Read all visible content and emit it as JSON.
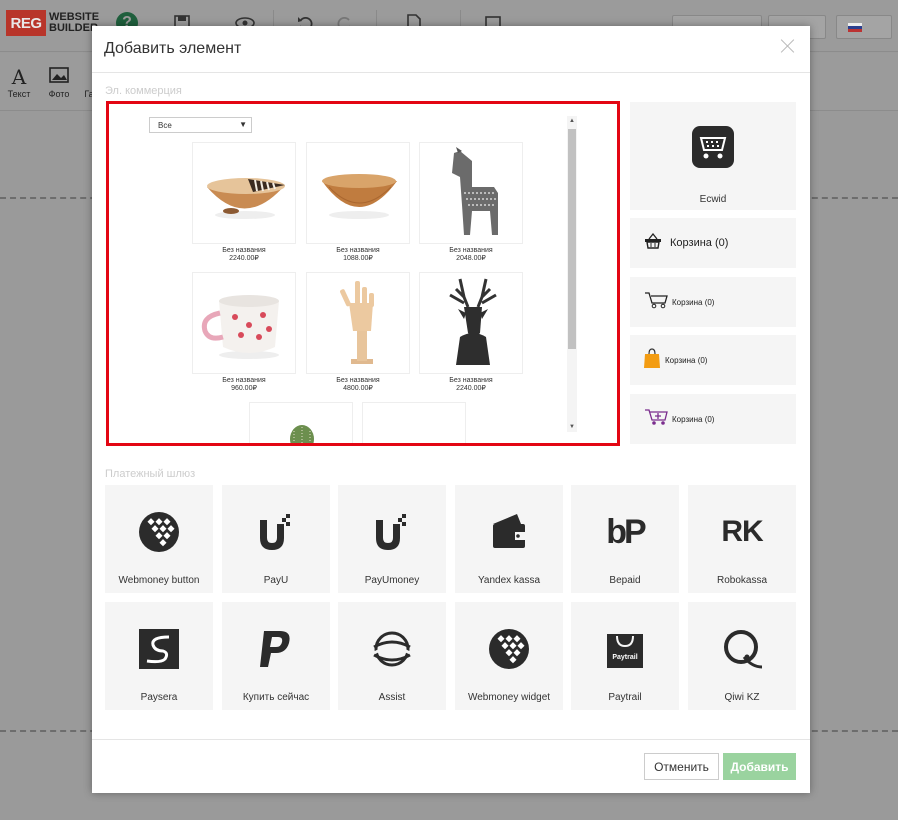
{
  "app": {
    "logo_mark": "REG",
    "logo_line1": "WEBSITE",
    "logo_line2": "BUILDER",
    "help_glyph": "?",
    "tools": [
      {
        "label": "Текст",
        "glyph": "A"
      },
      {
        "label": "Фото",
        "glyph": "▣"
      },
      {
        "label": "Га",
        "glyph": ""
      }
    ]
  },
  "modal": {
    "title": "Добавить элемент",
    "ecommerce_label": "Эл. коммерция",
    "payment_label": "Платежный шлюз",
    "preview": {
      "filter_value": "Все",
      "products": [
        {
          "name": "Без названия",
          "price": "2240.00₽",
          "kind": "bowl-striped"
        },
        {
          "name": "Без названия",
          "price": "1088.00₽",
          "kind": "bowl-wood"
        },
        {
          "name": "Без названия",
          "price": "2048.00₽",
          "kind": "horse"
        },
        {
          "name": "Без названия",
          "price": "960.00₽",
          "kind": "mug"
        },
        {
          "name": "Без названия",
          "price": "4800.00₽",
          "kind": "hand"
        },
        {
          "name": "Без названия",
          "price": "2240.00₽",
          "kind": "deer"
        }
      ]
    },
    "ecwid_label": "Ecwid",
    "carts": [
      {
        "label": "Корзина (0)",
        "icon": "basket-icon"
      },
      {
        "label": "Корзина (0)",
        "icon": "cart-outline-icon"
      },
      {
        "label": "Корзина (0)",
        "icon": "shopping-bag-icon"
      },
      {
        "label": "Корзина (0)",
        "icon": "cart-plus-icon"
      }
    ],
    "payments": [
      {
        "label": "Webmoney button",
        "icon": "webmoney-icon"
      },
      {
        "label": "PayU",
        "icon": "payu-icon"
      },
      {
        "label": "PayUmoney",
        "icon": "payumoney-icon"
      },
      {
        "label": "Yandex kassa",
        "icon": "wallet-icon"
      },
      {
        "label": "Bepaid",
        "icon": "bepaid-icon",
        "mark": "bP"
      },
      {
        "label": "Robokassa",
        "icon": "robokassa-icon",
        "mark": "RK"
      },
      {
        "label": "Paysera",
        "icon": "paysera-icon"
      },
      {
        "label": "Купить сейчас",
        "icon": "paypal-icon"
      },
      {
        "label": "Assist",
        "icon": "assist-icon"
      },
      {
        "label": "Webmoney widget",
        "icon": "webmoney-icon"
      },
      {
        "label": "Paytrail",
        "icon": "paytrail-icon",
        "mark": "Paytrail"
      },
      {
        "label": "Qiwi KZ",
        "icon": "qiwi-icon"
      }
    ],
    "cancel_label": "Отменить",
    "add_label": "Добавить"
  },
  "colors": {
    "highlight": "#e30613",
    "add_button": "#9ad39f",
    "bag": "#f39c12",
    "cart_plus": "#7b2d8e"
  }
}
